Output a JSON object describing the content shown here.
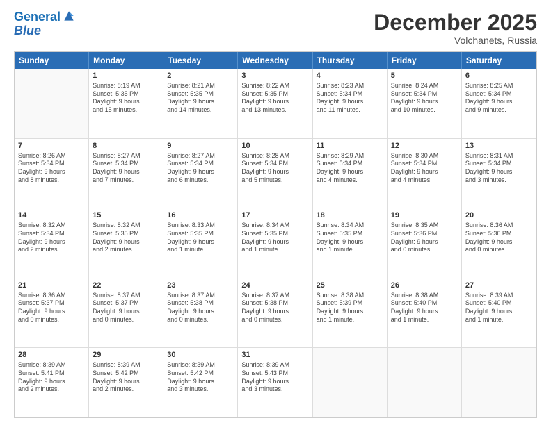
{
  "header": {
    "logo_line1": "General",
    "logo_line2": "Blue",
    "month": "December 2025",
    "location": "Volchanets, Russia"
  },
  "weekdays": [
    "Sunday",
    "Monday",
    "Tuesday",
    "Wednesday",
    "Thursday",
    "Friday",
    "Saturday"
  ],
  "rows": [
    [
      {
        "day": "",
        "info": ""
      },
      {
        "day": "1",
        "info": "Sunrise: 8:19 AM\nSunset: 5:35 PM\nDaylight: 9 hours\nand 15 minutes."
      },
      {
        "day": "2",
        "info": "Sunrise: 8:21 AM\nSunset: 5:35 PM\nDaylight: 9 hours\nand 14 minutes."
      },
      {
        "day": "3",
        "info": "Sunrise: 8:22 AM\nSunset: 5:35 PM\nDaylight: 9 hours\nand 13 minutes."
      },
      {
        "day": "4",
        "info": "Sunrise: 8:23 AM\nSunset: 5:34 PM\nDaylight: 9 hours\nand 11 minutes."
      },
      {
        "day": "5",
        "info": "Sunrise: 8:24 AM\nSunset: 5:34 PM\nDaylight: 9 hours\nand 10 minutes."
      },
      {
        "day": "6",
        "info": "Sunrise: 8:25 AM\nSunset: 5:34 PM\nDaylight: 9 hours\nand 9 minutes."
      }
    ],
    [
      {
        "day": "7",
        "info": "Sunrise: 8:26 AM\nSunset: 5:34 PM\nDaylight: 9 hours\nand 8 minutes."
      },
      {
        "day": "8",
        "info": "Sunrise: 8:27 AM\nSunset: 5:34 PM\nDaylight: 9 hours\nand 7 minutes."
      },
      {
        "day": "9",
        "info": "Sunrise: 8:27 AM\nSunset: 5:34 PM\nDaylight: 9 hours\nand 6 minutes."
      },
      {
        "day": "10",
        "info": "Sunrise: 8:28 AM\nSunset: 5:34 PM\nDaylight: 9 hours\nand 5 minutes."
      },
      {
        "day": "11",
        "info": "Sunrise: 8:29 AM\nSunset: 5:34 PM\nDaylight: 9 hours\nand 4 minutes."
      },
      {
        "day": "12",
        "info": "Sunrise: 8:30 AM\nSunset: 5:34 PM\nDaylight: 9 hours\nand 4 minutes."
      },
      {
        "day": "13",
        "info": "Sunrise: 8:31 AM\nSunset: 5:34 PM\nDaylight: 9 hours\nand 3 minutes."
      }
    ],
    [
      {
        "day": "14",
        "info": "Sunrise: 8:32 AM\nSunset: 5:34 PM\nDaylight: 9 hours\nand 2 minutes."
      },
      {
        "day": "15",
        "info": "Sunrise: 8:32 AM\nSunset: 5:35 PM\nDaylight: 9 hours\nand 2 minutes."
      },
      {
        "day": "16",
        "info": "Sunrise: 8:33 AM\nSunset: 5:35 PM\nDaylight: 9 hours\nand 1 minute."
      },
      {
        "day": "17",
        "info": "Sunrise: 8:34 AM\nSunset: 5:35 PM\nDaylight: 9 hours\nand 1 minute."
      },
      {
        "day": "18",
        "info": "Sunrise: 8:34 AM\nSunset: 5:35 PM\nDaylight: 9 hours\nand 1 minute."
      },
      {
        "day": "19",
        "info": "Sunrise: 8:35 AM\nSunset: 5:36 PM\nDaylight: 9 hours\nand 0 minutes."
      },
      {
        "day": "20",
        "info": "Sunrise: 8:36 AM\nSunset: 5:36 PM\nDaylight: 9 hours\nand 0 minutes."
      }
    ],
    [
      {
        "day": "21",
        "info": "Sunrise: 8:36 AM\nSunset: 5:37 PM\nDaylight: 9 hours\nand 0 minutes."
      },
      {
        "day": "22",
        "info": "Sunrise: 8:37 AM\nSunset: 5:37 PM\nDaylight: 9 hours\nand 0 minutes."
      },
      {
        "day": "23",
        "info": "Sunrise: 8:37 AM\nSunset: 5:38 PM\nDaylight: 9 hours\nand 0 minutes."
      },
      {
        "day": "24",
        "info": "Sunrise: 8:37 AM\nSunset: 5:38 PM\nDaylight: 9 hours\nand 0 minutes."
      },
      {
        "day": "25",
        "info": "Sunrise: 8:38 AM\nSunset: 5:39 PM\nDaylight: 9 hours\nand 1 minute."
      },
      {
        "day": "26",
        "info": "Sunrise: 8:38 AM\nSunset: 5:40 PM\nDaylight: 9 hours\nand 1 minute."
      },
      {
        "day": "27",
        "info": "Sunrise: 8:39 AM\nSunset: 5:40 PM\nDaylight: 9 hours\nand 1 minute."
      }
    ],
    [
      {
        "day": "28",
        "info": "Sunrise: 8:39 AM\nSunset: 5:41 PM\nDaylight: 9 hours\nand 2 minutes."
      },
      {
        "day": "29",
        "info": "Sunrise: 8:39 AM\nSunset: 5:42 PM\nDaylight: 9 hours\nand 2 minutes."
      },
      {
        "day": "30",
        "info": "Sunrise: 8:39 AM\nSunset: 5:42 PM\nDaylight: 9 hours\nand 3 minutes."
      },
      {
        "day": "31",
        "info": "Sunrise: 8:39 AM\nSunset: 5:43 PM\nDaylight: 9 hours\nand 3 minutes."
      },
      {
        "day": "",
        "info": ""
      },
      {
        "day": "",
        "info": ""
      },
      {
        "day": "",
        "info": ""
      }
    ]
  ]
}
